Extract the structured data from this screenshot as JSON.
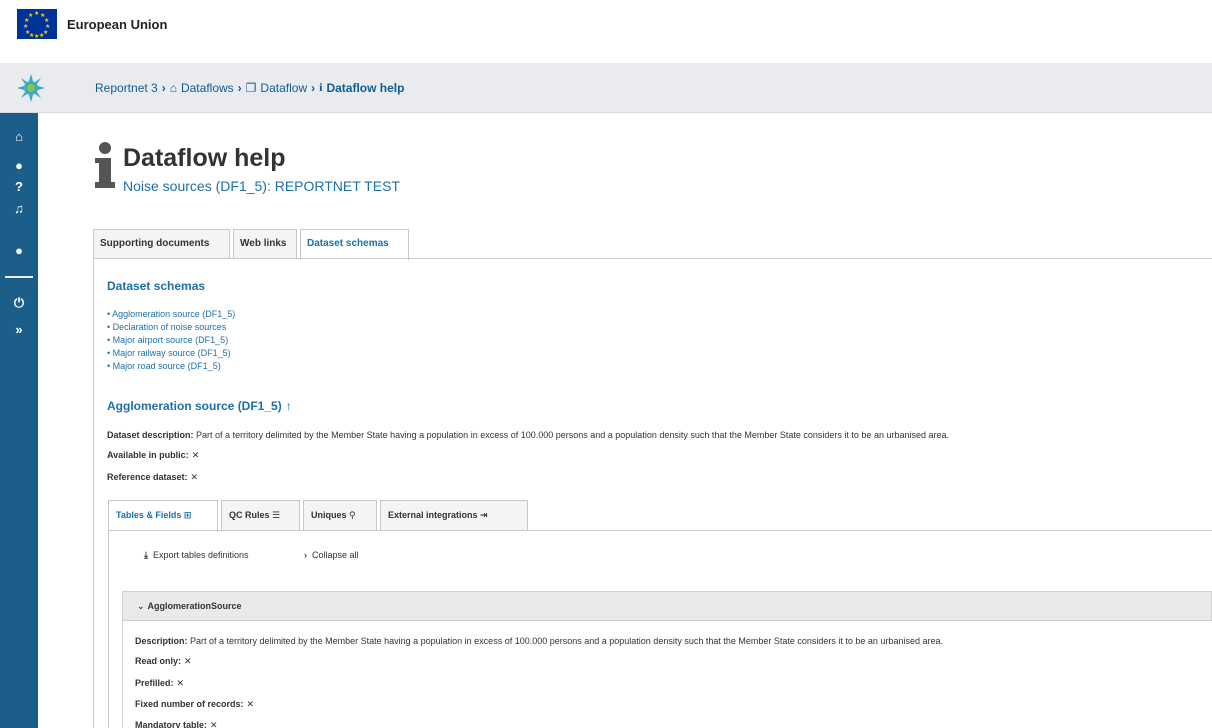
{
  "eu_bar": {
    "title": "European Union"
  },
  "breadcrumb": [
    {
      "label": "Reportnet 3",
      "icon": ""
    },
    {
      "label": "Dataflows",
      "icon": "home-icon"
    },
    {
      "label": "Dataflow",
      "icon": "clone-icon"
    },
    {
      "label": "Dataflow help",
      "icon": "info-icon"
    }
  ],
  "left_nav": {
    "icons": [
      "home-icon",
      "user-icon",
      "help-icon",
      "bell-icon",
      "chat-icon",
      "power-icon",
      "expand-icon"
    ]
  },
  "page": {
    "title": "Dataflow help",
    "subtitle": "Noise sources (DF1_5): REPORTNET TEST"
  },
  "tabs": [
    {
      "label": "Supporting documents",
      "active": false
    },
    {
      "label": "Web links",
      "active": false
    },
    {
      "label": "Dataset schemas",
      "active": true
    }
  ],
  "dataset_schemas": {
    "title": "Dataset schemas",
    "items": [
      "• Agglomeration source (DF1_5)",
      "• Declaration of noise sources",
      "• Major airport source (DF1_5)",
      "• Major railway source (DF1_5)",
      "• Major road source (DF1_5)"
    ]
  },
  "schema_detail": {
    "title": "Agglomeration source (DF1_5)",
    "arrow": "↑",
    "description_label": "Dataset description:",
    "description": "Part of a territory delimited by the Member State having a population in excess of 100.000 persons and a population density such that the Member State considers it to be an urbanised area.",
    "public_label": "Available in public:",
    "reference_label": "Reference dataset:",
    "cross": "✕"
  },
  "subtabs": [
    {
      "label": "Tables & Fields",
      "icon": "⊞",
      "active": true
    },
    {
      "label": "QC Rules",
      "icon": "☰",
      "active": false
    },
    {
      "label": "Uniques",
      "icon": "⚲",
      "active": false
    },
    {
      "label": "External integrations",
      "icon": "⇥",
      "active": false
    }
  ],
  "toolbar": {
    "export_label": "Export tables definitions",
    "collapse_label": "Collapse all"
  },
  "table": {
    "name": "AgglomerationSource",
    "description_label": "Description:",
    "description": "Part of a territory delimited by the Member State having a population in excess of 100.000 persons and a population density such that the Member State considers it to be an urbanised area.",
    "read_only_label": "Read only:",
    "prefilled_label": "Prefilled:",
    "fixed_label": "Fixed number of records:",
    "mandatory_label": "Mandatory table:",
    "cross": "✕"
  },
  "colors": {
    "eu_blue": "#003399",
    "eu_gold": "#ffcc00",
    "nav_blue": "#1b5e8a",
    "link_blue": "#1e6fa8",
    "header_gray": "#e9ebee"
  }
}
